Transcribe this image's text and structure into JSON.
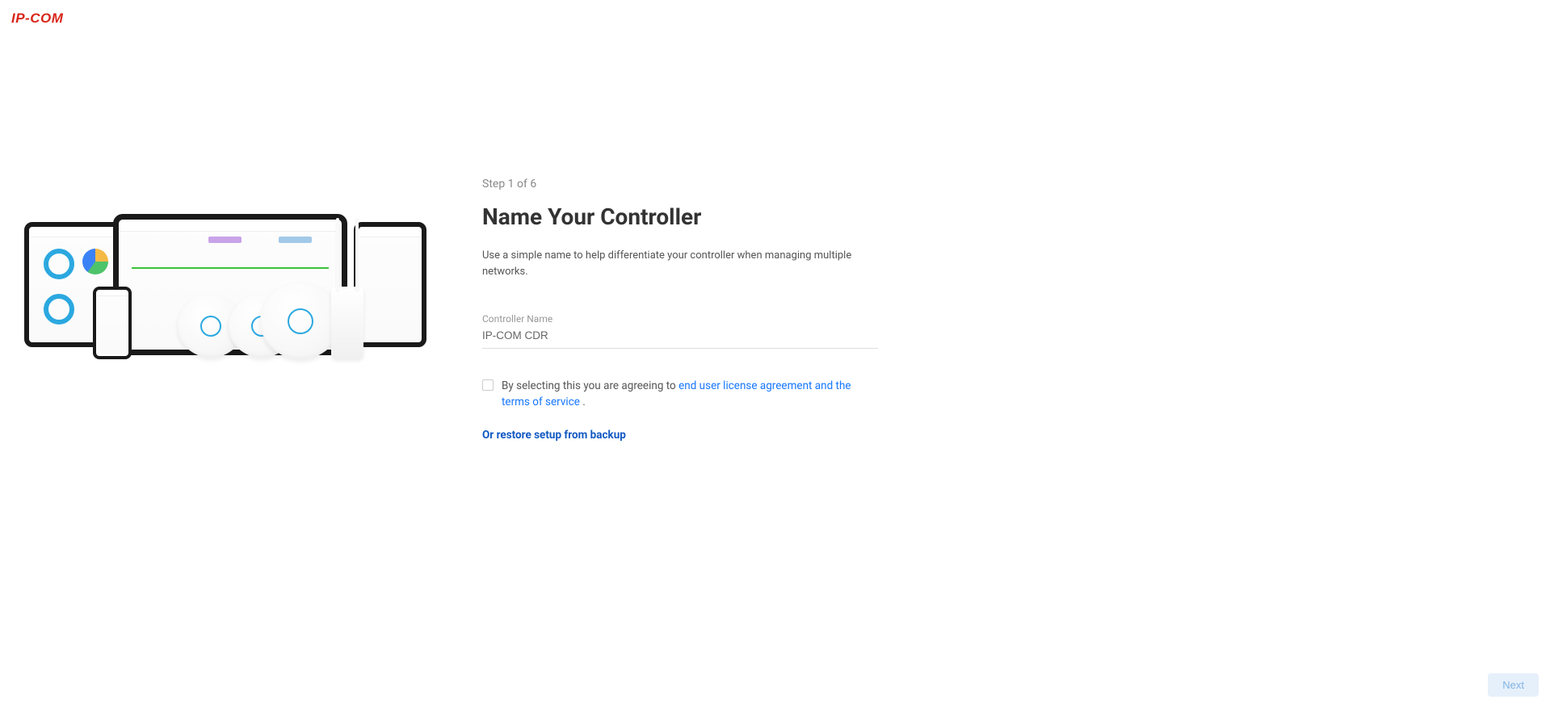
{
  "brand": {
    "logo_text": "IP-COM"
  },
  "wizard": {
    "step_text": "Step 1 of 6",
    "title": "Name Your Controller",
    "description": "Use a simple name to help differentiate your controller when managing multiple networks.",
    "field_label": "Controller Name",
    "controller_name_value": "IP-COM CDR",
    "checkbox_text_before": "By selecting this you are agreeing to ",
    "checkbox_link_text": "end user license agreement and the terms of service",
    "checkbox_text_after": " .",
    "restore_link": "Or restore setup from backup",
    "next_button": "Next"
  }
}
